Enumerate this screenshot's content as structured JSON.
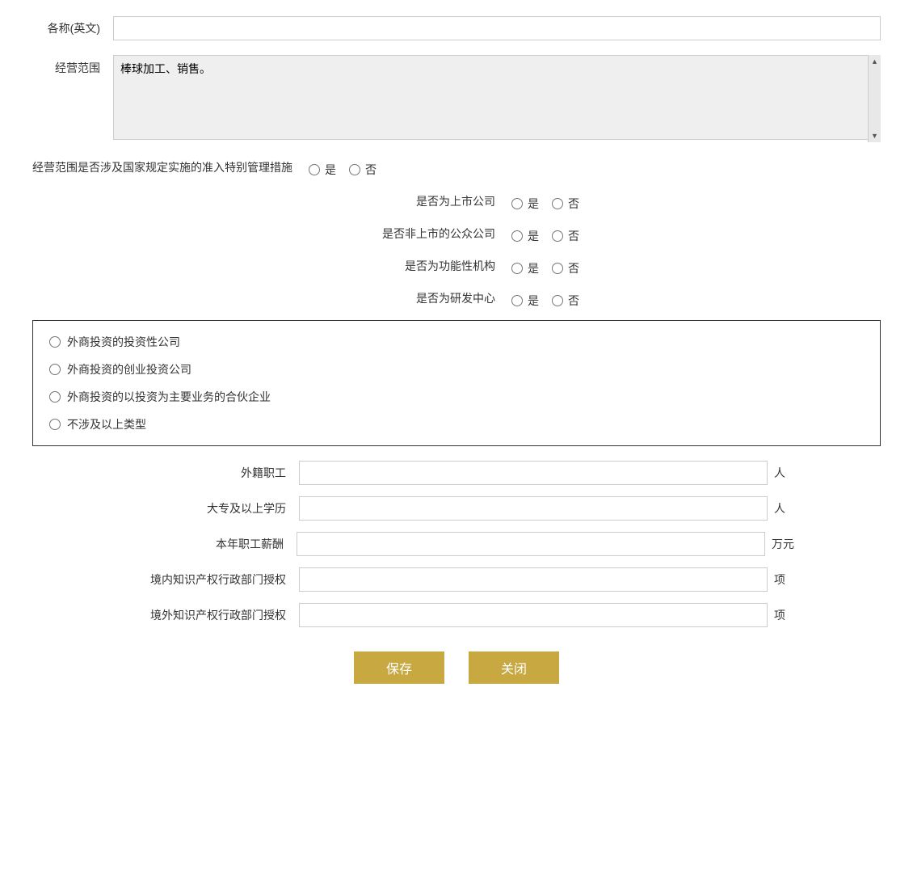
{
  "form": {
    "name_english_label": "各称(英文)",
    "name_english_value": "",
    "business_scope_label": "经营范围",
    "business_scope_value": "棒球加工、销售。",
    "special_management_label": "经营范围是否涉及国家规定实施的准入特别管理措施",
    "yes_label": "是",
    "no_label": "否",
    "listed_company_label": "是否为上市公司",
    "non_listed_public_label": "是否非上市的公众公司",
    "functional_institution_label": "是否为功能性机构",
    "rd_center_label": "是否为研发中心",
    "box_options": [
      "外商投资的投资性公司",
      "外商投资的创业投资公司",
      "外商投资的以投资为主要业务的合伙企业",
      "不涉及以上类型"
    ],
    "foreign_staff_label": "外籍职工",
    "foreign_staff_unit": "人",
    "college_edu_label": "大专及以上学历",
    "college_edu_unit": "人",
    "annual_salary_label": "本年职工薪酬",
    "annual_salary_unit": "万元",
    "domestic_ip_label": "境内知识产权行政部门授权",
    "domestic_ip_unit": "项",
    "foreign_ip_label": "境外知识产权行政部门授权",
    "foreign_ip_unit": "项",
    "save_button": "保存",
    "close_button": "关闭"
  }
}
